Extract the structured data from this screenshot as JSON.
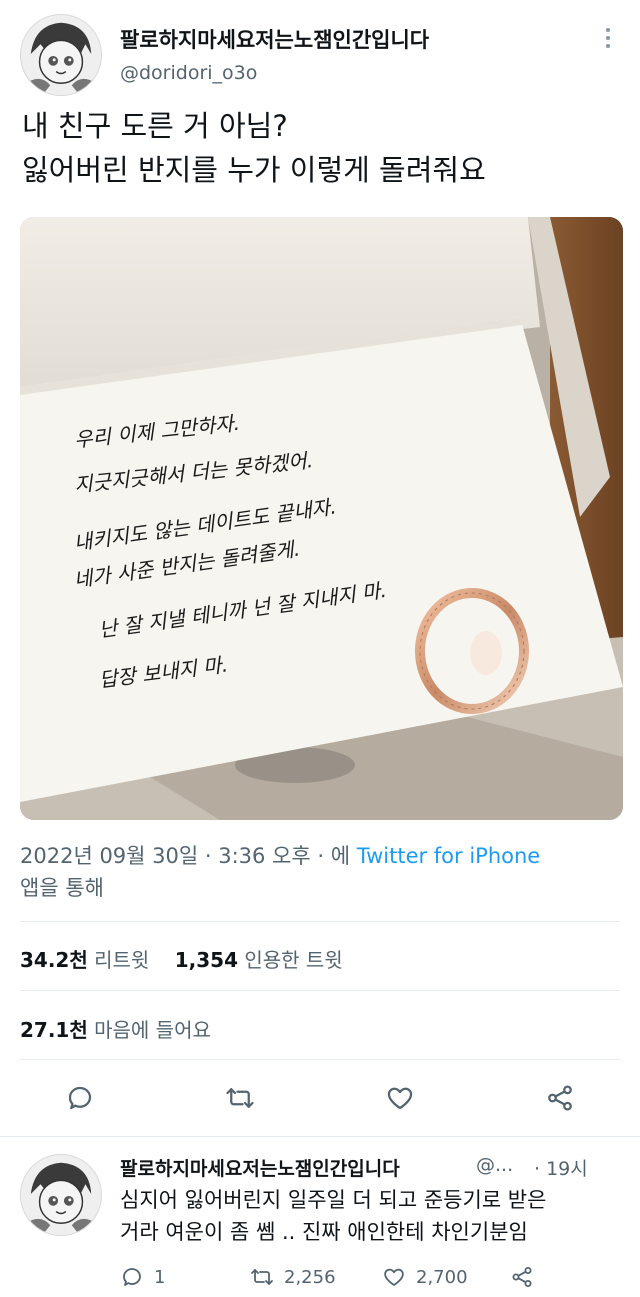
{
  "tweet": {
    "display_name": "팔로하지마세요저는노잼인간입니다",
    "handle": "@doridori_o3o",
    "text_lines": [
      "내 친구 도른 거 아님?",
      "잃어버린 반지를 누가 이렇게 돌려줘요"
    ],
    "photo": {
      "note_lines": [
        "우리 이제 그만하자.",
        "지긋지긋해서 더는 못하겠어.",
        "내키지도 않는 데이트도 끝내자.",
        "네가 사준 반지는 돌려줄게.",
        "난 잘 지낼 테니까 넌 잘 지내지 마.",
        "답장 보내지 마."
      ]
    },
    "timestamp": "2022년 09월 30일 · 3:36 오후 · 에",
    "source_link": "Twitter for iPhone",
    "source_suffix": "앱을 통해",
    "retweets_value": "34.2천",
    "retweets_label": "리트윗",
    "quotes_value": "1,354",
    "quotes_label": "인용한 트윗",
    "likes_value": "27.1천",
    "likes_label": "마음에 들어요"
  },
  "icons": {
    "more": "more-vertical-icon",
    "reply": "reply-icon",
    "retweet": "retweet-icon",
    "like": "heart-icon",
    "share": "share-icon"
  },
  "reply": {
    "display_name": "팔로하지마세요저는노잼인간입니다",
    "handle": "@...",
    "time": "· 19시",
    "text_lines": [
      "심지어 잃어버린지 일주일 더 되고 준등기로 받은",
      "거라 여운이 좀 쎔 .. 진짜 애인한테 차인기분임"
    ],
    "reply_count": "1",
    "retweet_count": "2,256",
    "like_count": "2,700"
  },
  "colors": {
    "text": "#0f1419",
    "muted": "#536471",
    "link": "#1d9bf0",
    "divider": "#e6ecf0"
  }
}
